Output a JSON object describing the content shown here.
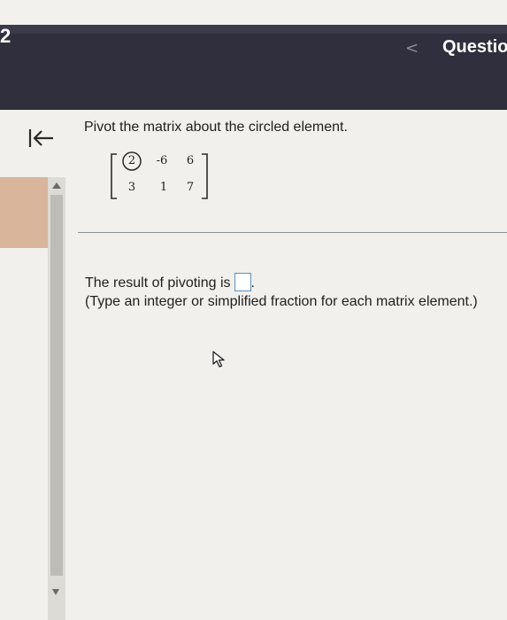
{
  "header": {
    "question_number": "2",
    "prev_arrow": "<",
    "question_label": "Questio"
  },
  "sidebar": {
    "collapse_icon": "collapse-left-icon"
  },
  "question": {
    "prompt": "Pivot the matrix about the circled element.",
    "matrix": {
      "rows": [
        [
          "2",
          "-6",
          "6"
        ],
        [
          "3",
          "1",
          "7"
        ]
      ],
      "circled": "2"
    },
    "result_text": "The result of pivoting is",
    "result_period": ".",
    "instruction": "(Type an integer or simplified fraction for each matrix element.)"
  },
  "colors": {
    "header_bg": "#2f2f3d",
    "content_bg": "#f1f0ec",
    "side_panel": "#d8b59b",
    "answer_box_border": "#5a8fc0"
  }
}
